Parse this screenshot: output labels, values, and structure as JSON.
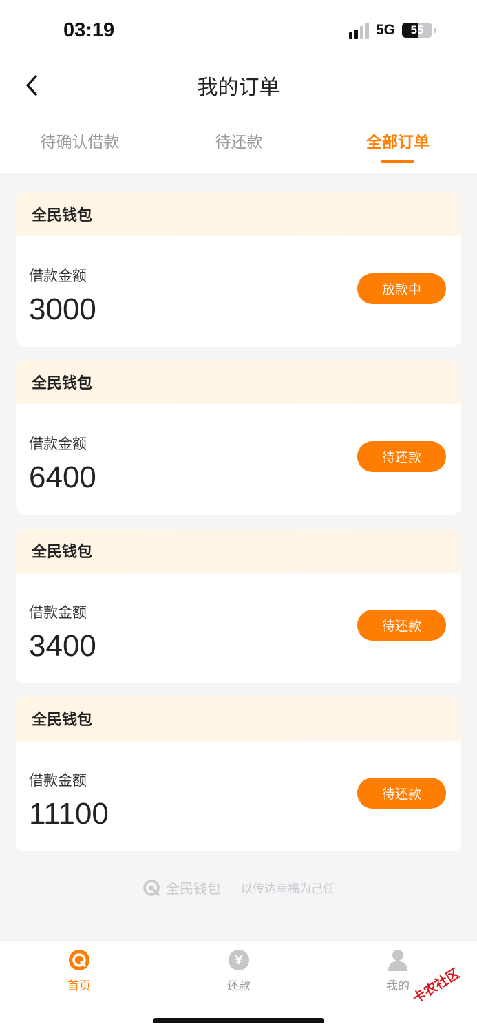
{
  "status_bar": {
    "time": "03:19",
    "network": "5G",
    "battery": "55"
  },
  "nav": {
    "title": "我的订单"
  },
  "tabs": [
    {
      "label": "待确认借款"
    },
    {
      "label": "待还款"
    },
    {
      "label": "全部订单"
    }
  ],
  "orders": [
    {
      "brand": "全民钱包",
      "label": "借款金额",
      "amount": "3000",
      "status": "放款中"
    },
    {
      "brand": "全民钱包",
      "label": "借款金额",
      "amount": "6400",
      "status": "待还款"
    },
    {
      "brand": "全民钱包",
      "label": "借款金额",
      "amount": "3400",
      "status": "待还款"
    },
    {
      "brand": "全民钱包",
      "label": "借款金额",
      "amount": "11100",
      "status": "待还款"
    }
  ],
  "footer": {
    "brand": "全民钱包",
    "slogan": "以传达幸福为己任"
  },
  "tabbar": [
    {
      "label": "首页"
    },
    {
      "label": "还款"
    },
    {
      "label": "我的"
    }
  ],
  "watermark": "卡农社区",
  "colors": {
    "accent": "#ff7d00",
    "card_header": "#fff6e6",
    "background": "#f4f5f7"
  },
  "icons": [
    "back-chevron-icon",
    "signal-icon",
    "battery-icon",
    "home-icon",
    "repay-yuan-icon",
    "profile-icon",
    "brand-logo-icon"
  ]
}
